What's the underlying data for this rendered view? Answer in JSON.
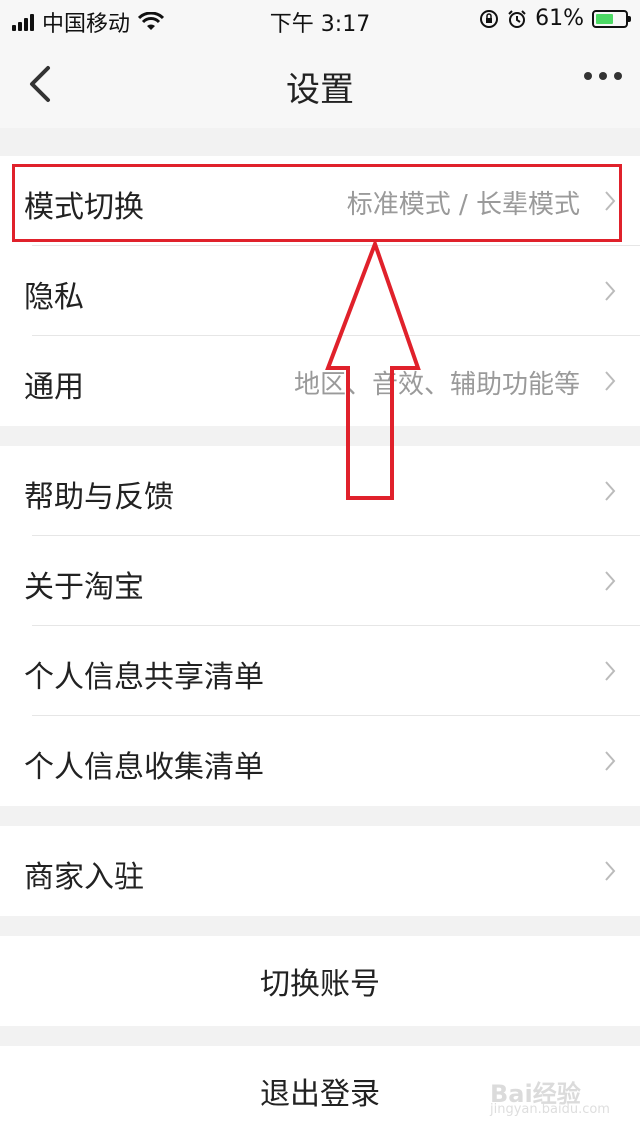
{
  "status_bar": {
    "carrier": "中国移动",
    "time": "下午 3:17",
    "battery_percent": "61%",
    "battery_level": 0.61,
    "icons": [
      "signal-icon",
      "wifi-icon",
      "rotation-lock-icon",
      "alarm-icon",
      "battery-charging-icon"
    ]
  },
  "nav": {
    "title": "设置",
    "back_icon": "chevron-left-icon",
    "more_icon": "more-dots-icon"
  },
  "group1": {
    "items": [
      {
        "label": "模式切换",
        "value": "标准模式 / 长辈模式"
      },
      {
        "label": "隐私",
        "value": ""
      },
      {
        "label": "通用",
        "value": "地区、音效、辅助功能等"
      }
    ]
  },
  "group2": {
    "items": [
      {
        "label": "帮助与反馈"
      },
      {
        "label": "关于淘宝"
      },
      {
        "label": "个人信息共享清单"
      },
      {
        "label": "个人信息收集清单"
      }
    ]
  },
  "group3": {
    "items": [
      {
        "label": "商家入驻"
      }
    ]
  },
  "actions": {
    "switch_account": "切换账号",
    "logout": "退出登录"
  },
  "annotation": {
    "highlight_color": "#e0212b"
  },
  "watermark": {
    "text": "Bai经验",
    "sub": "jingyan.baidu.com"
  }
}
